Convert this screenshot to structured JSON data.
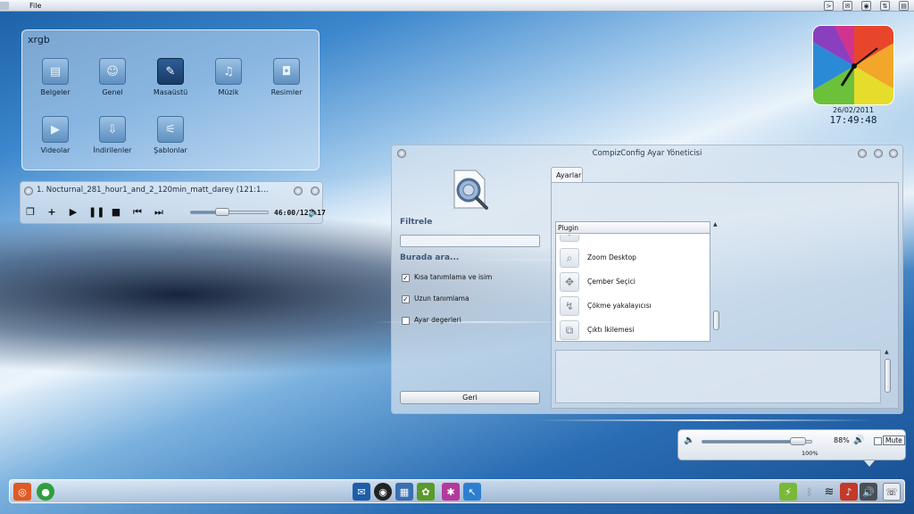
{
  "topbar": {
    "menu_file": "File",
    "tray_icons": [
      "terminal-icon",
      "mail-icon",
      "disk-icon",
      "network-icon",
      "document-icon"
    ]
  },
  "places": {
    "title": "xrgb",
    "folders": [
      {
        "label": "Belgeler",
        "icon": "document-folder-icon"
      },
      {
        "label": "Genel",
        "icon": "user-folder-icon"
      },
      {
        "label": "Masaüstü",
        "icon": "desktop-folder-icon"
      },
      {
        "label": "Müzik",
        "icon": "music-folder-icon"
      },
      {
        "label": "Resimler",
        "icon": "pictures-folder-icon"
      },
      {
        "label": "Videolar",
        "icon": "videos-folder-icon"
      },
      {
        "label": "İndirilenler",
        "icon": "downloads-folder-icon"
      },
      {
        "label": "Şablonlar",
        "icon": "templates-folder-icon"
      }
    ]
  },
  "player": {
    "track": "1. Nocturnal_281_hour1_and_2_120min_matt_darey (121:1...",
    "time": "46:00/121:17",
    "progress_fraction": 0.38,
    "controls": [
      "playlist-icon",
      "add-icon",
      "play-icon",
      "pause-icon",
      "stop-icon",
      "previous-icon",
      "next-icon"
    ]
  },
  "clock": {
    "date": "26/02/2011",
    "time": "17:49:48"
  },
  "ccsm": {
    "title": "CompizConfig Ayar Yöneticisi",
    "filter_label": "Filtrele",
    "search_label": "Burada ara...",
    "checks": [
      {
        "label": "Kısa tanımlama ve isim",
        "checked": true
      },
      {
        "label": "Uzun tanımlama",
        "checked": true
      },
      {
        "label": "Ayar degerleri",
        "checked": false
      }
    ],
    "back_button": "Geri",
    "tab": "Ayarlar",
    "list_header": "Plugin",
    "plugins": [
      {
        "name": "Zoom Desktop",
        "icon": "zoom-icon"
      },
      {
        "name": "Çember Seçici",
        "icon": "ring-switcher-icon"
      },
      {
        "name": "Çökme yakalayıcısı",
        "icon": "crash-handler-icon"
      },
      {
        "name": "Çıktı İkilemesi",
        "icon": "clone-output-icon"
      }
    ]
  },
  "volume": {
    "percent": "88%",
    "level_fraction": 0.88,
    "mute_label": "Mute",
    "note": "100%"
  },
  "panel": {
    "launchers": [
      "ubuntu-icon",
      "pidgin-icon",
      "thunderbird-icon",
      "rhythmbox-icon",
      "workspace-icon",
      "gimp-icon",
      "compiz-icon",
      "cursor-icon"
    ],
    "tray": [
      "battery-icon",
      "bluetooth-icon",
      "wifi-icon",
      "music-indicator-icon",
      "volume-icon",
      "logout-icon"
    ]
  }
}
